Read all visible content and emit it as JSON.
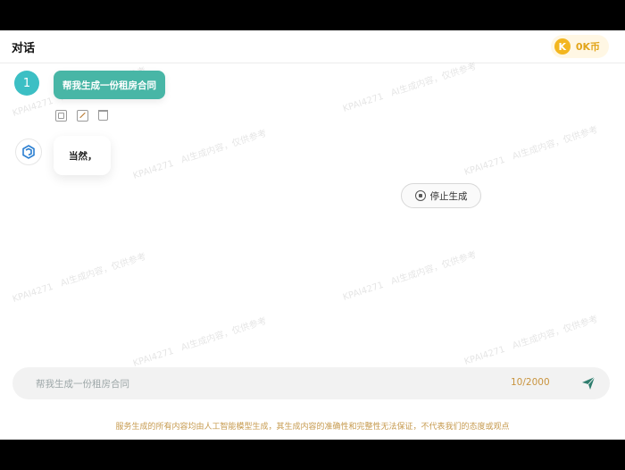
{
  "header": {
    "title": "对话",
    "coin_label": "0K币",
    "coin_icon": "K"
  },
  "watermark": {
    "text_a": "KPAI4271",
    "text_b": "AI生成内容，仅供参考"
  },
  "conversation": {
    "user_avatar": "1",
    "user_message": "帮我生成一份租房合同",
    "bot_message": "当然，"
  },
  "controls": {
    "stop_label": "停止生成"
  },
  "input": {
    "value": "帮我生成一份租房合同",
    "counter": "10/2000"
  },
  "footer": {
    "disclaimer": "服务生成的所有内容均由人工智能模型生成，其生成内容的准确性和完整性无法保证，不代表我们的态度或观点"
  },
  "colors": {
    "accent": "#48b6a6",
    "coin": "#f3b61f",
    "counter": "#c9943f"
  }
}
